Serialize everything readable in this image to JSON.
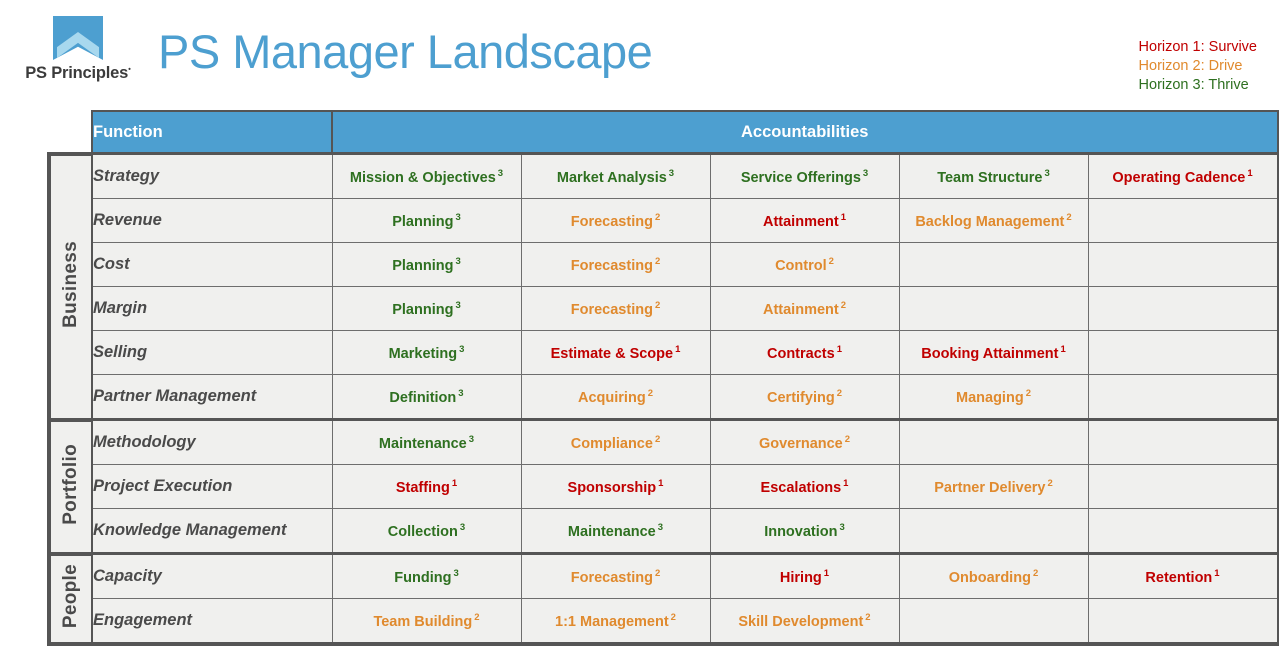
{
  "brand": {
    "logo_text": "PS Principles",
    "logo_trademark": "˙",
    "logo_icon": "banner-chevron-logo",
    "accent_color": "#4d9fd0"
  },
  "header": {
    "title": "PS Manager Landscape"
  },
  "legend": {
    "items": [
      {
        "label": "Horizon 1: Survive",
        "color": "#c00000",
        "horizon": 1
      },
      {
        "label": "Horizon 2: Drive",
        "color": "#e08a2e",
        "horizon": 2
      },
      {
        "label": "Horizon 3: Thrive",
        "color": "#2e7020",
        "horizon": 3
      }
    ]
  },
  "table": {
    "headers": {
      "function": "Function",
      "accountabilities": "Accountabilities"
    },
    "groups": [
      {
        "name": "Business",
        "rows": [
          {
            "function": "Strategy",
            "accountabilities": [
              {
                "label": "Mission & Objectives",
                "horizon": "3"
              },
              {
                "label": "Market Analysis",
                "horizon": "3"
              },
              {
                "label": "Service Offerings",
                "horizon": "3"
              },
              {
                "label": "Team Structure",
                "horizon": "3"
              },
              {
                "label": "Operating Cadence",
                "horizon": "1"
              }
            ]
          },
          {
            "function": "Revenue",
            "accountabilities": [
              {
                "label": "Planning",
                "horizon": "3"
              },
              {
                "label": "Forecasting",
                "horizon": "2"
              },
              {
                "label": "Attainment",
                "horizon": "1"
              },
              {
                "label": "Backlog Management",
                "horizon": "2"
              },
              {
                "label": "",
                "horizon": ""
              }
            ]
          },
          {
            "function": "Cost",
            "accountabilities": [
              {
                "label": "Planning",
                "horizon": "3"
              },
              {
                "label": "Forecasting",
                "horizon": "2"
              },
              {
                "label": "Control",
                "horizon": "2"
              },
              {
                "label": "",
                "horizon": ""
              },
              {
                "label": "",
                "horizon": ""
              }
            ]
          },
          {
            "function": "Margin",
            "accountabilities": [
              {
                "label": "Planning",
                "horizon": "3"
              },
              {
                "label": "Forecasting",
                "horizon": "2"
              },
              {
                "label": "Attainment",
                "horizon": "2"
              },
              {
                "label": "",
                "horizon": ""
              },
              {
                "label": "",
                "horizon": ""
              }
            ]
          },
          {
            "function": "Selling",
            "accountabilities": [
              {
                "label": "Marketing",
                "horizon": "3"
              },
              {
                "label": "Estimate & Scope",
                "horizon": "1"
              },
              {
                "label": "Contracts",
                "horizon": "1"
              },
              {
                "label": "Booking Attainment",
                "horizon": "1"
              },
              {
                "label": "",
                "horizon": ""
              }
            ]
          },
          {
            "function": "Partner Management",
            "accountabilities": [
              {
                "label": "Definition",
                "horizon": "3"
              },
              {
                "label": "Acquiring",
                "horizon": "2"
              },
              {
                "label": "Certifying",
                "horizon": "2"
              },
              {
                "label": "Managing",
                "horizon": "2"
              },
              {
                "label": "",
                "horizon": ""
              }
            ]
          }
        ]
      },
      {
        "name": "Portfolio",
        "rows": [
          {
            "function": "Methodology",
            "accountabilities": [
              {
                "label": "Maintenance",
                "horizon": "3"
              },
              {
                "label": "Compliance",
                "horizon": "2"
              },
              {
                "label": "Governance",
                "horizon": "2"
              },
              {
                "label": "",
                "horizon": ""
              },
              {
                "label": "",
                "horizon": ""
              }
            ]
          },
          {
            "function": "Project Execution",
            "accountabilities": [
              {
                "label": "Staffing",
                "horizon": "1"
              },
              {
                "label": "Sponsorship",
                "horizon": "1"
              },
              {
                "label": "Escalations",
                "horizon": "1"
              },
              {
                "label": "Partner Delivery",
                "horizon": "2"
              },
              {
                "label": "",
                "horizon": ""
              }
            ]
          },
          {
            "function": "Knowledge Management",
            "accountabilities": [
              {
                "label": "Collection",
                "horizon": "3"
              },
              {
                "label": "Maintenance",
                "horizon": "3"
              },
              {
                "label": "Innovation",
                "horizon": "3"
              },
              {
                "label": "",
                "horizon": ""
              },
              {
                "label": "",
                "horizon": ""
              }
            ]
          }
        ]
      },
      {
        "name": "People",
        "rows": [
          {
            "function": "Capacity",
            "accountabilities": [
              {
                "label": "Funding",
                "horizon": "3"
              },
              {
                "label": "Forecasting",
                "horizon": "2"
              },
              {
                "label": "Hiring",
                "horizon": "1"
              },
              {
                "label": "Onboarding",
                "horizon": "2"
              },
              {
                "label": "Retention",
                "horizon": "1"
              }
            ]
          },
          {
            "function": "Engagement",
            "accountabilities": [
              {
                "label": "Team Building",
                "horizon": "2"
              },
              {
                "label": "1:1 Management",
                "horizon": "2"
              },
              {
                "label": "Skill Development",
                "horizon": "2"
              },
              {
                "label": "",
                "horizon": ""
              },
              {
                "label": "",
                "horizon": ""
              }
            ]
          }
        ]
      }
    ]
  }
}
